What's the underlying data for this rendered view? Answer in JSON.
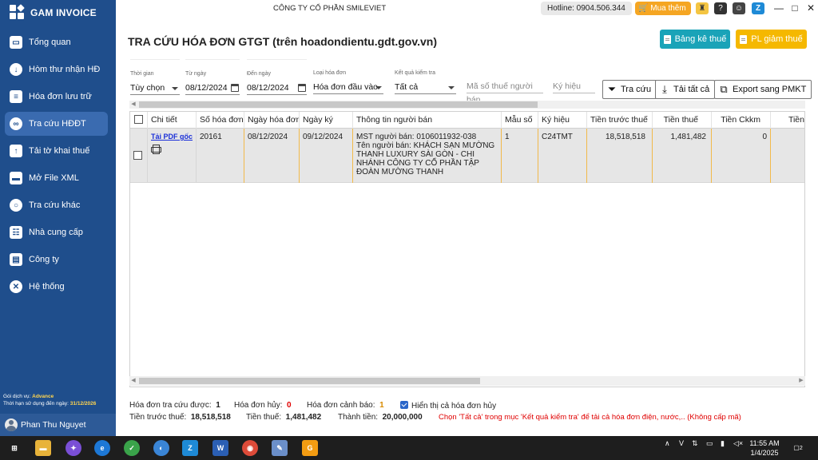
{
  "app": {
    "brand": "GAM INVOICE",
    "company": "CÔNG TY CỔ PHẦN SMILEVIET",
    "hotline": "Hotline: 0904.506.344",
    "buy_label": "Mua thêm"
  },
  "sidebar": {
    "items": [
      {
        "label": "Tổng quan",
        "icon": "monitor-icon"
      },
      {
        "label": "Hòm thư nhận HĐ",
        "icon": "download-icon"
      },
      {
        "label": "Hóa đơn lưu trữ",
        "icon": "document-icon"
      },
      {
        "label": "Tra cứu HĐĐT",
        "icon": "link-icon"
      },
      {
        "label": "Tải tờ khai thuế",
        "icon": "upload-icon"
      },
      {
        "label": "Mở File XML",
        "icon": "folder-icon"
      },
      {
        "label": "Tra cứu khác",
        "icon": "search-icon"
      },
      {
        "label": "Nhà cung cấp",
        "icon": "contacts-icon"
      },
      {
        "label": "Công ty",
        "icon": "building-icon"
      },
      {
        "label": "Hệ thống",
        "icon": "tools-icon"
      }
    ],
    "active_index": 3,
    "service_label": "Gói dịch vụ:",
    "service_value": "Advance",
    "expiry_label": "Thời hạn sử dụng đến ngày:",
    "expiry_value": "31/12/2026",
    "user": "Phan Thu Nguyet"
  },
  "header": {
    "title": "TRA CỨU HÓA ĐƠN GTGT (trên hoadondientu.gdt.gov.vn)",
    "btn_bangke": "Bảng kê thuế",
    "btn_pl": "PL giảm thuế"
  },
  "filters": {
    "time": {
      "label": "Thời gian",
      "value": "Tùy chọn"
    },
    "from": {
      "label": "Từ ngày",
      "value": "08/12/2024"
    },
    "to": {
      "label": "Đến ngày",
      "value": "08/12/2024"
    },
    "type": {
      "label": "Loại hóa đơn",
      "value": "Hóa đơn đầu vào"
    },
    "result": {
      "label": "Kết quả kiểm tra",
      "value": "Tất cả"
    },
    "tax_placeholder": "Mã số thuế người bán",
    "symbol_placeholder": "Ký hiệu",
    "btn_search": "Tra cứu",
    "btn_download": "Tải tất cả",
    "btn_export": "Export sang PMKT"
  },
  "grid": {
    "columns": [
      "Chi tiết",
      "Số hóa đơn",
      "Ngày hóa đơn",
      "Ngày ký",
      "Thông tin người bán",
      "Mẫu số",
      "Ký hiệu",
      "Tiền trước thuế",
      "Tiền thuế",
      "Tiền Ckkm",
      "Tiền"
    ],
    "rows": [
      {
        "detail_link": "Tải PDF gốc",
        "invoice_no": "20161",
        "invoice_date": "08/12/2024",
        "sign_date": "09/12/2024",
        "seller": "MST người bán: 0106011932-038\nTên người bán: KHÁCH SẠN MƯỜNG THANH LUXURY SÀI GÒN - CHI NHÁNH CÔNG TY CỔ PHẦN TẬP ĐOÀN MƯỜNG THANH",
        "form": "1",
        "symbol": "C24TMT",
        "pre_tax": "18,518,518",
        "tax": "1,481,482",
        "discount": "0"
      }
    ]
  },
  "summary": {
    "found_label": "Hóa đơn tra cứu được:",
    "found": "1",
    "cancel_label": "Hóa đơn hủy:",
    "cancel": "0",
    "warn_label": "Hóa đơn cảnh báo:",
    "warn": "1",
    "show_cancel": "Hiển thị cả hóa đơn hủy",
    "pretax_label": "Tiền trước thuế:",
    "pretax": "18,518,518",
    "tax_label": "Tiền thuế:",
    "tax": "1,481,482",
    "total_label": "Thành tiền:",
    "total": "20,000,000",
    "note": "Chọn 'Tất cả' trong mục 'Kết quả kiểm tra' để tải cả hóa đơn điện, nước,.. (Không cấp mã)"
  },
  "taskbar": {
    "time": "11:55 AM",
    "date": "1/4/2025",
    "notifications": "2"
  },
  "colors": {
    "sidebar": "#1f4e8c",
    "accent_teal": "#1aa3b8",
    "accent_yellow": "#f5b800",
    "buy": "#f5a623",
    "warn_red": "#e00000"
  }
}
